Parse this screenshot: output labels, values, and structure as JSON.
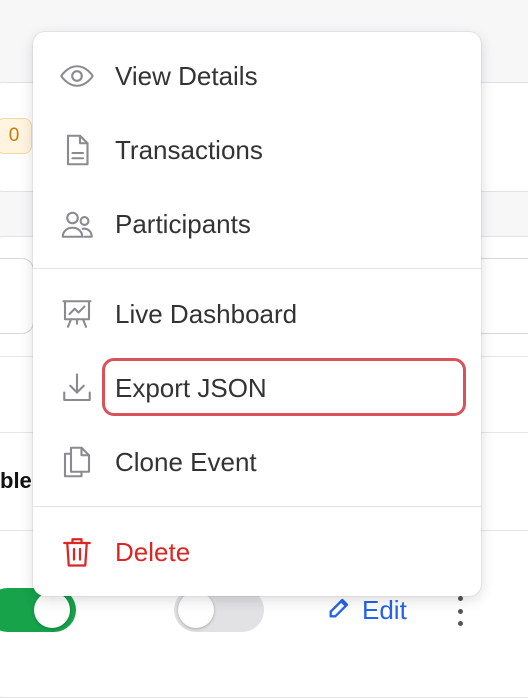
{
  "background": {
    "badge_value": "0",
    "truncated_label": "ble",
    "edit_label": "Edit",
    "toggle_primary": "on",
    "toggle_secondary": "off"
  },
  "menu": {
    "items": [
      {
        "label": "View Details",
        "icon": "eye-icon"
      },
      {
        "label": "Transactions",
        "icon": "document-icon"
      },
      {
        "label": "Participants",
        "icon": "users-icon"
      },
      {
        "label": "Live Dashboard",
        "icon": "presentation-chart-icon"
      },
      {
        "label": "Export JSON",
        "icon": "download-icon"
      },
      {
        "label": "Clone Event",
        "icon": "copy-icon"
      },
      {
        "label": "Delete",
        "icon": "trash-icon"
      }
    ]
  },
  "colors": {
    "accent": "#2563eb",
    "success": "#16a34a",
    "danger": "#dc2626",
    "highlight": "#d9515b"
  }
}
